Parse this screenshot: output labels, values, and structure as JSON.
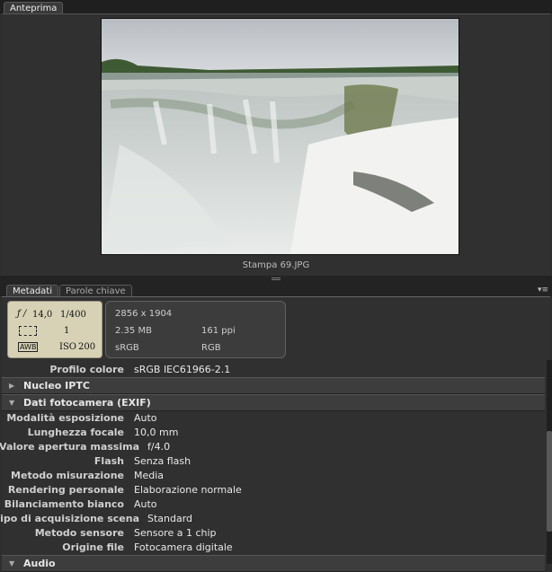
{
  "tabs_top": [
    "Anteprima"
  ],
  "preview": {
    "caption": "Stampa 69.JPG"
  },
  "tabs_meta": [
    "Metadati",
    "Parole chiave"
  ],
  "camera": {
    "aperture": "14,0",
    "shutter": "1/400",
    "exposure": "1",
    "iso": "200",
    "awb": "AWB"
  },
  "file": {
    "dimensions": "2856 x 1904",
    "size": "2.35 MB",
    "ppi": "161 ppi",
    "profile": "sRGB",
    "mode": "RGB"
  },
  "profilo": {
    "label": "Profilo colore",
    "value": "sRGB IEC61966-2.1"
  },
  "sections": {
    "iptc": "Nucleo IPTC",
    "exif": "Dati fotocamera (EXIF)",
    "audio": "Audio"
  },
  "exif_rows": [
    {
      "label": "Modalità esposizione",
      "value": "Auto"
    },
    {
      "label": "Lunghezza focale",
      "value": "10,0 mm"
    },
    {
      "label": "Valore apertura massima",
      "value": "f/4.0"
    },
    {
      "label": "Flash",
      "value": "Senza flash"
    },
    {
      "label": "Metodo misurazione",
      "value": "Media"
    },
    {
      "label": "Rendering personale",
      "value": "Elaborazione normale"
    },
    {
      "label": "Bilanciamento bianco",
      "value": "Auto"
    },
    {
      "label": "Tipo di acquisizione scena",
      "value": "Standard"
    },
    {
      "label": "Metodo sensore",
      "value": "Sensore a 1 chip"
    },
    {
      "label": "Origine file",
      "value": "Fotocamera digitale"
    }
  ]
}
